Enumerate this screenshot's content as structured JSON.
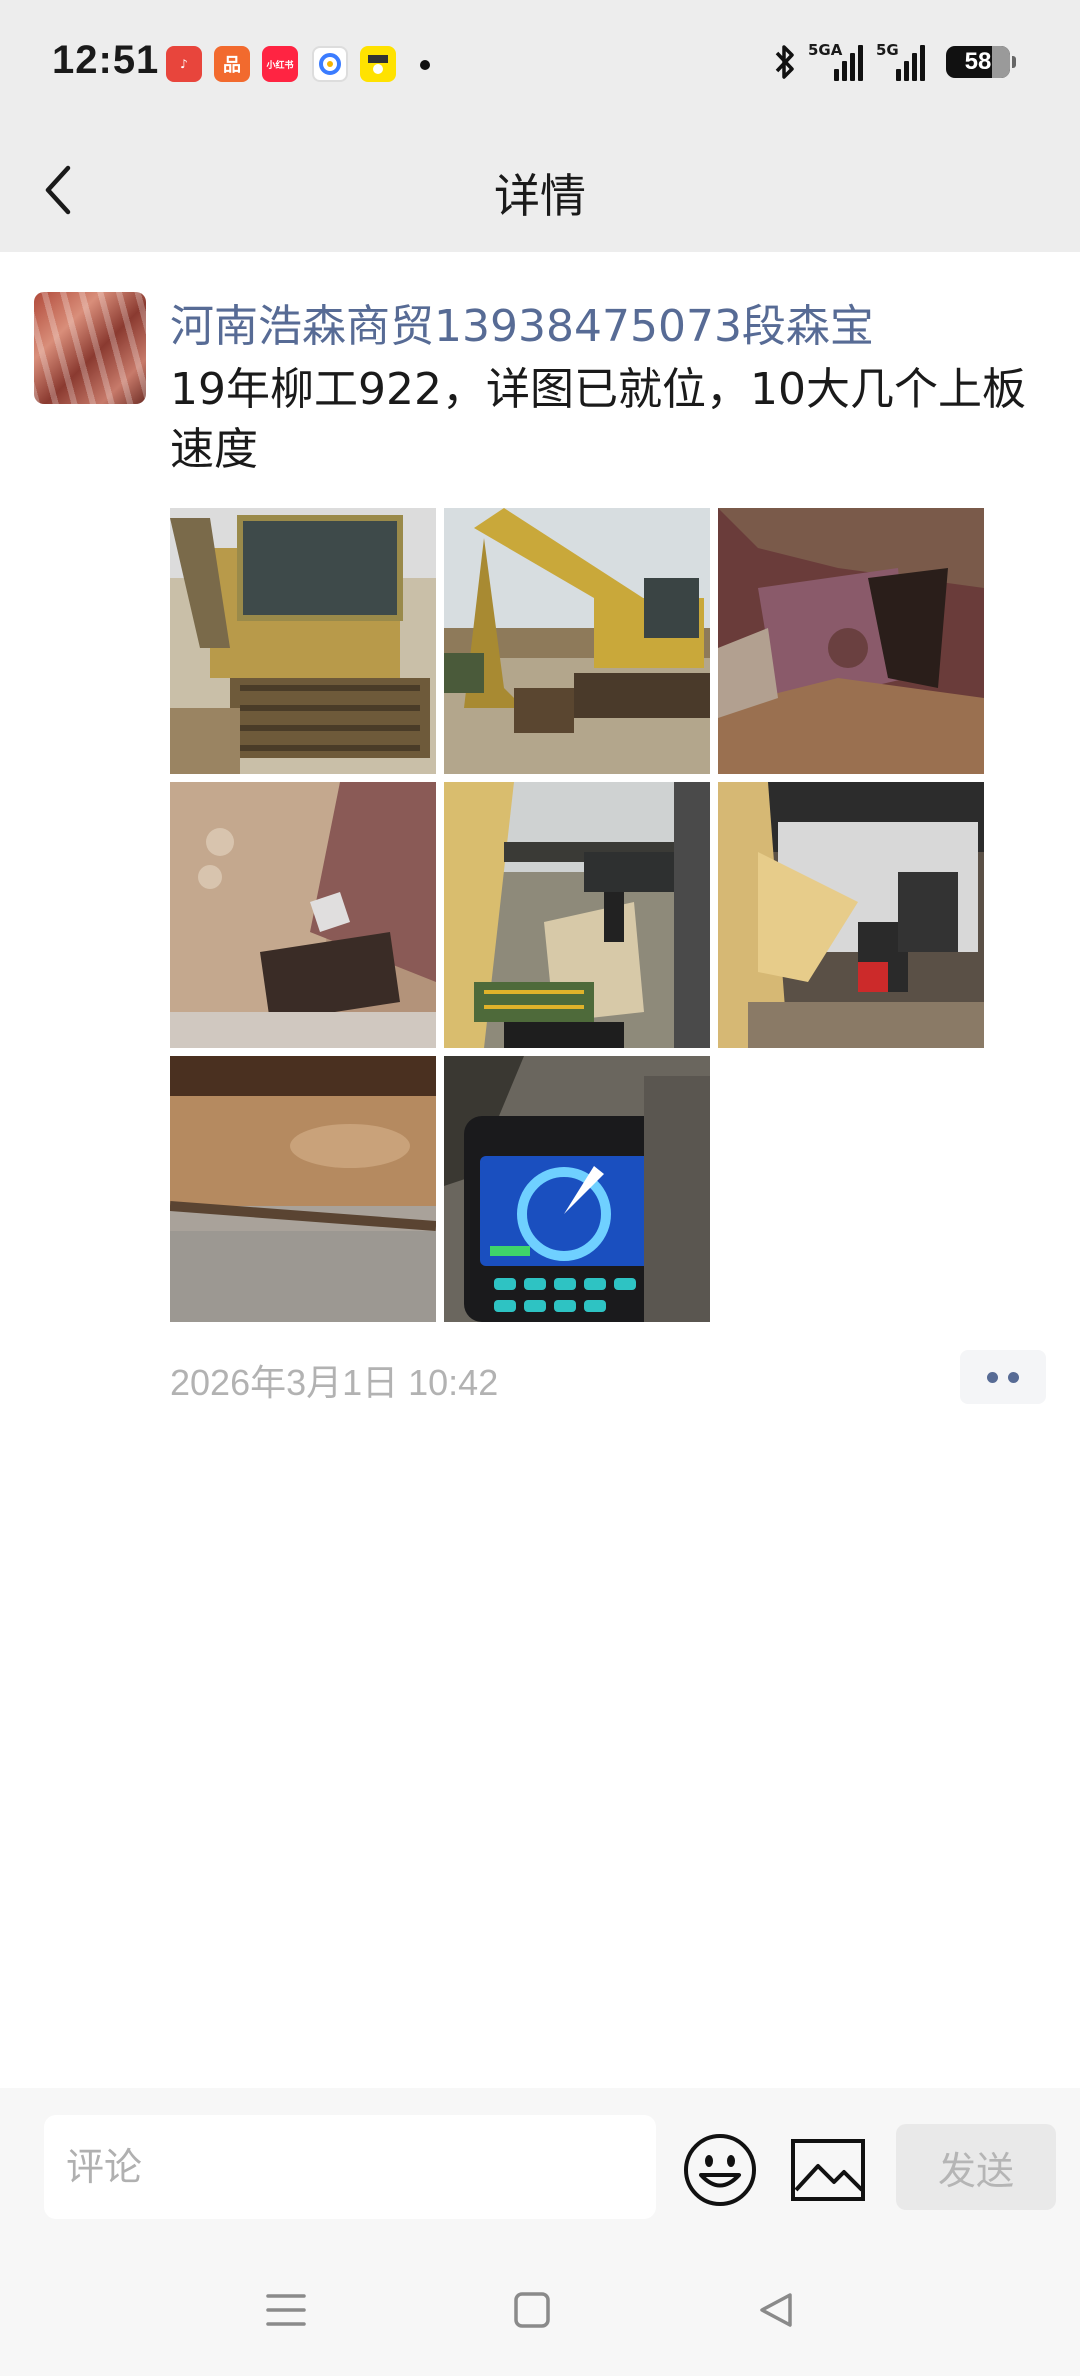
{
  "status_bar": {
    "time": "12:51",
    "notifications": [
      {
        "icon": "music-app-icon",
        "color": "#e8453c",
        "glyph": "♪"
      },
      {
        "icon": "shopping-app-icon",
        "color": "#f26a2e",
        "glyph": "品"
      },
      {
        "icon": "xiaohongshu-app-icon",
        "color": "#ff2442",
        "glyph": "小红书"
      },
      {
        "icon": "browser-app-icon",
        "color": "#ffffff",
        "glyph": ""
      },
      {
        "icon": "pet-app-icon",
        "color": "#ffe200",
        "glyph": ""
      }
    ],
    "signal1_label": "5GA",
    "signal2_label": "5G",
    "battery": "58"
  },
  "header": {
    "title": "详情"
  },
  "post": {
    "author": "河南浩森商贸13938475073段森宝",
    "text": "19年柳工922，详图已就位，10大几个上板速度",
    "photos": [
      {
        "name": "excavator-cab-photo"
      },
      {
        "name": "excavator-side-photo"
      },
      {
        "name": "track-rust-closeup-photo"
      },
      {
        "name": "bucket-wear-closeup-photo"
      },
      {
        "name": "cab-interior-photo"
      },
      {
        "name": "cab-controls-photo"
      },
      {
        "name": "metal-surface-closeup-photo"
      },
      {
        "name": "monitor-display-photo"
      }
    ],
    "timestamp": "2026年3月1日 10:42"
  },
  "comment_bar": {
    "placeholder": "评论",
    "send_label": "发送"
  },
  "colors": {
    "author_link": "#576b95",
    "timestamp": "#b2b2b2",
    "header_bg": "#ededed"
  }
}
